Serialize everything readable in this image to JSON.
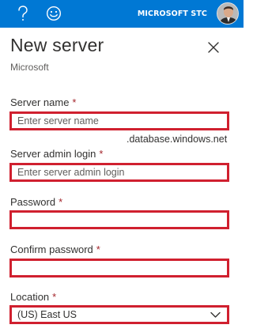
{
  "topbar": {
    "account_name": "MICROSOFT STC",
    "icons": [
      "help-icon",
      "smiley-icon"
    ]
  },
  "panel": {
    "title": "New server",
    "subtitle": "Microsoft"
  },
  "form": {
    "server_name": {
      "label": "Server name",
      "required_mark": "*",
      "placeholder": "Enter server name",
      "suffix": ".database.windows.net"
    },
    "admin_login": {
      "label": "Server admin login",
      "required_mark": "*",
      "placeholder": "Enter server admin login"
    },
    "password": {
      "label": "Password",
      "required_mark": "*",
      "placeholder": ""
    },
    "confirm_password": {
      "label": "Confirm password",
      "required_mark": "*",
      "placeholder": ""
    },
    "location": {
      "label": "Location",
      "required_mark": "*",
      "value": "(US) East US"
    }
  },
  "colors": {
    "topbar": "#0078d4",
    "highlight_border": "#d0202f",
    "required": "#a4262c"
  }
}
